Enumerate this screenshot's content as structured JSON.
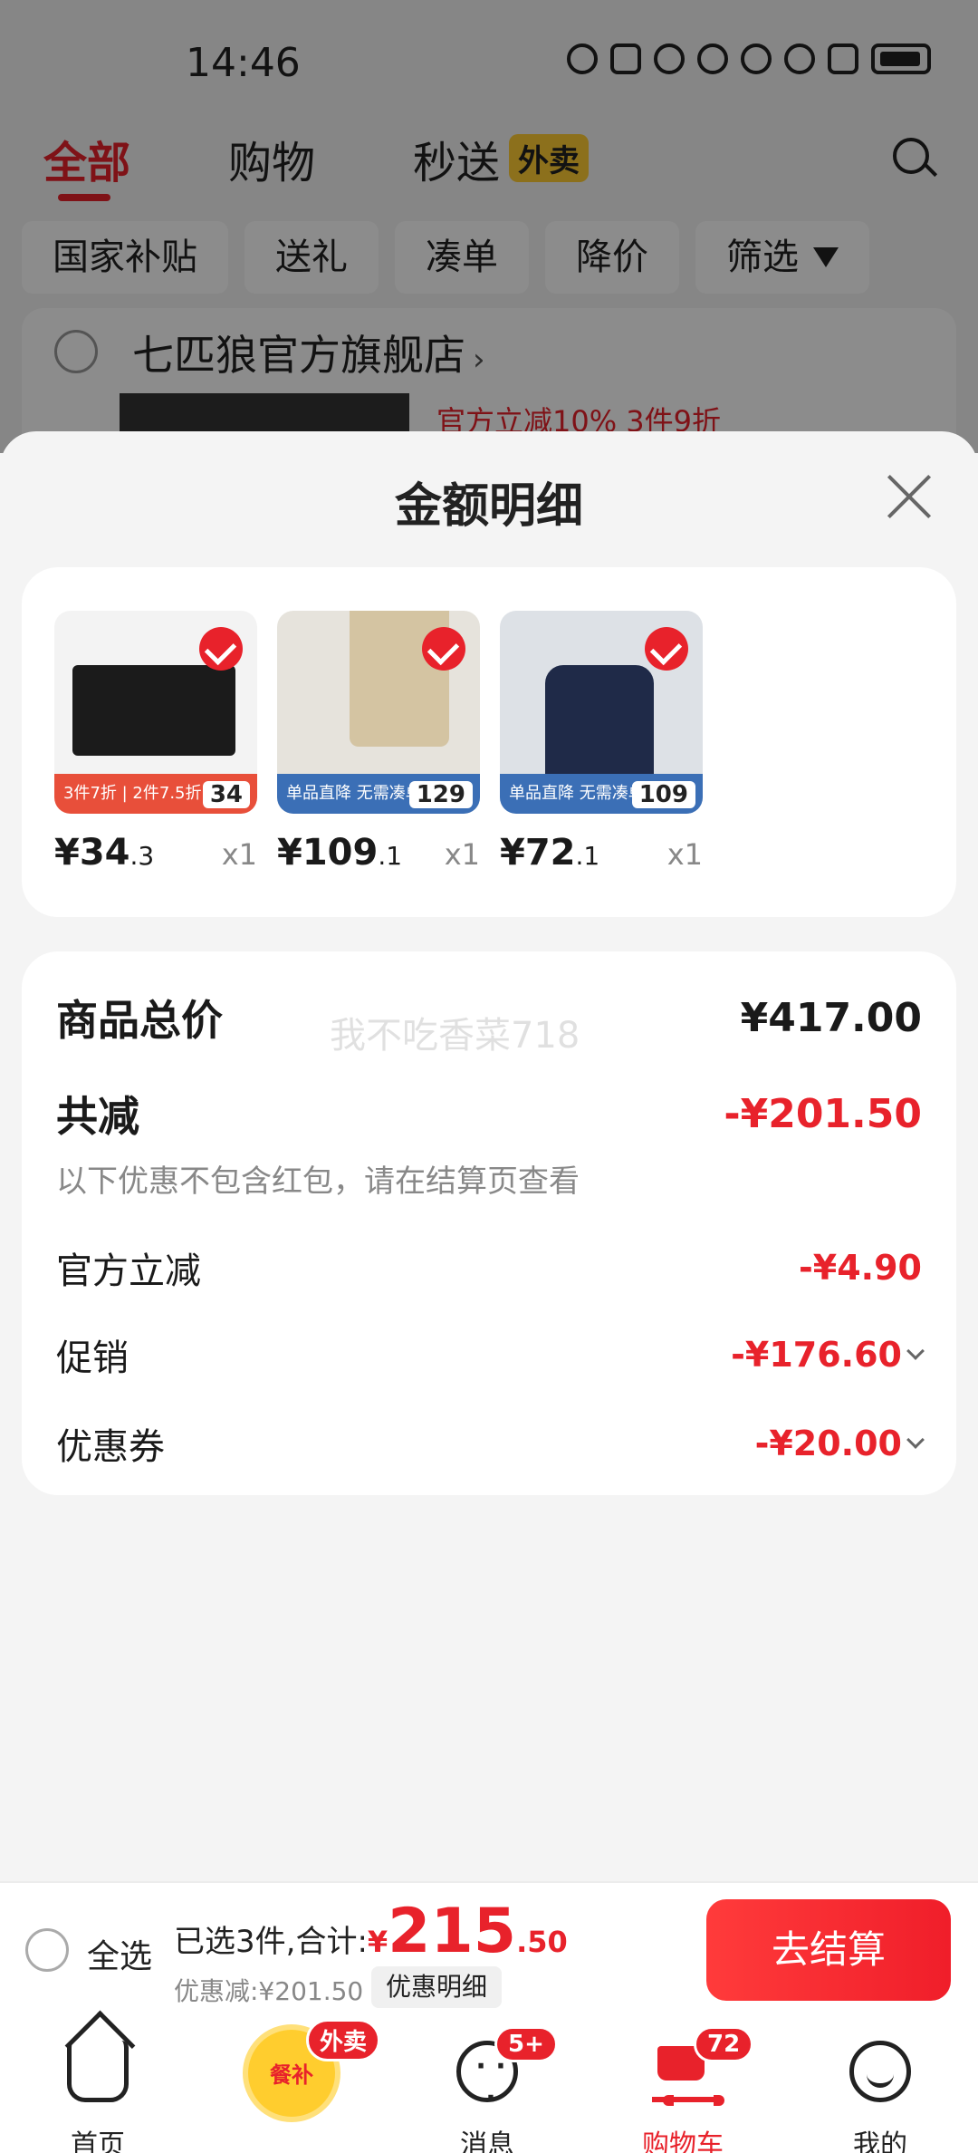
{
  "status_bar": {
    "time": "14:46"
  },
  "top_nav": {
    "tabs": [
      "全部",
      "购物",
      "秒送"
    ],
    "waimai_tag": "外卖",
    "filters": [
      "国家补贴",
      "送礼",
      "凑单",
      "降价",
      "筛选"
    ]
  },
  "store": {
    "name": "七匹狼官方旗舰店",
    "arrow": "›",
    "promo": "官方立减10%  3件9折"
  },
  "sheet": {
    "title": "金额明细",
    "items": [
      {
        "price_int": "¥34",
        "price_dec": ".3",
        "qty": "x1",
        "banner": "3件7折 | 2件7.5折",
        "tag_price": "34"
      },
      {
        "price_int": "¥109",
        "price_dec": ".1",
        "qty": "x1",
        "banner": "单品直降 无需凑单",
        "tag_price": "129"
      },
      {
        "price_int": "¥72",
        "price_dec": ".1",
        "qty": "x1",
        "banner": "单品直降 无需凑单",
        "tag_price": "109"
      }
    ],
    "summary": {
      "total_label": "商品总价",
      "total_value": "¥417.00",
      "watermark": "我不吃香菜718",
      "reduce_label": "共减",
      "reduce_value": "-¥201.50",
      "note": "以下优惠不包含红包，请在结算页查看",
      "lines": [
        {
          "label": "官方立减",
          "value": "-¥4.90"
        },
        {
          "label": "促销",
          "value": "-¥176.60"
        },
        {
          "label": "优惠券",
          "value": "-¥20.00"
        }
      ]
    }
  },
  "action_bar": {
    "select_all": "全选",
    "selected_text": "已选3件,合计:",
    "currency": "¥",
    "total_int": "215",
    "total_dec": ".50",
    "discount": "优惠减:¥201.50",
    "detail_button": "优惠明细",
    "checkout_button": "去结算"
  },
  "tab_bar": {
    "tabs": [
      {
        "label": "首页"
      },
      {
        "label": "餐补",
        "badge": "外卖"
      },
      {
        "label": "消息",
        "badge": "5+"
      },
      {
        "label": "购物车",
        "badge": "72"
      },
      {
        "label": "我的"
      }
    ]
  },
  "colors": {
    "accent": "#e8222b",
    "background": "#f4f4f4",
    "waimai": "#ffcc33"
  }
}
